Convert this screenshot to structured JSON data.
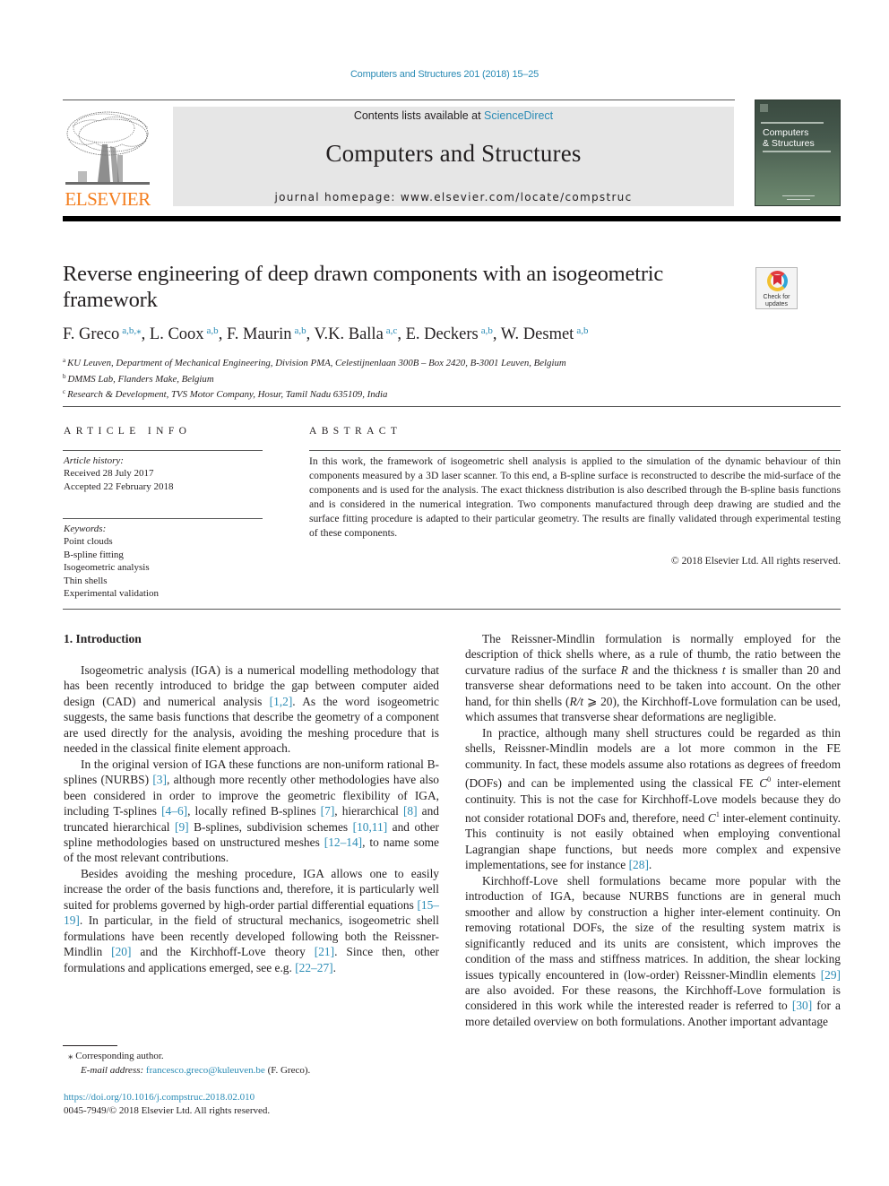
{
  "running_head": "Computers and Structures 201 (2018) 15–25",
  "masthead": {
    "publisher_wordmark": "ELSEVIER",
    "contents_prefix": "Contents lists available at ",
    "contents_link": "ScienceDirect",
    "journal_name": "Computers and Structures",
    "homepage_prefix": "journal homepage: ",
    "homepage_url": "www.elsevier.com/locate/compstruc",
    "cover_title_line1": "Computers",
    "cover_title_line2": "& Structures"
  },
  "check_updates": {
    "line1": "Check for",
    "line2": "updates"
  },
  "article": {
    "title": "Reverse engineering of deep drawn components with an isogeometric framework",
    "authors": [
      {
        "name": "F. Greco",
        "aff": "a,b,⁎",
        "sep": ", "
      },
      {
        "name": "L. Coox",
        "aff": "a,b",
        "sep": ", "
      },
      {
        "name": "F. Maurin",
        "aff": "a,b",
        "sep": ", "
      },
      {
        "name": "V.K. Balla",
        "aff": "a,c",
        "sep": ", "
      },
      {
        "name": "E. Deckers",
        "aff": "a,b",
        "sep": ", "
      },
      {
        "name": "W. Desmet",
        "aff": "a,b",
        "sep": ""
      }
    ],
    "affiliations": [
      {
        "mark": "a",
        "text": "KU Leuven, Department of Mechanical Engineering, Division PMA, Celestijnenlaan 300B – Box 2420, B-3001 Leuven, Belgium"
      },
      {
        "mark": "b",
        "text": "DMMS Lab, Flanders Make, Belgium"
      },
      {
        "mark": "c",
        "text": "Research & Development, TVS Motor Company, Hosur, Tamil Nadu 635109, India"
      }
    ]
  },
  "article_info": {
    "heading": "ARTICLE INFO",
    "history_label": "Article history:",
    "received": "Received 28 July 2017",
    "accepted": "Accepted 22 February 2018",
    "keywords_label": "Keywords:",
    "keywords": [
      "Point clouds",
      "B-spline fitting",
      "Isogeometric analysis",
      "Thin shells",
      "Experimental validation"
    ]
  },
  "abstract": {
    "heading": "ABSTRACT",
    "text": "In this work, the framework of isogeometric shell analysis is applied to the simulation of the dynamic behaviour of thin components measured by a 3D laser scanner. To this end, a B-spline surface is reconstructed to describe the mid-surface of the components and is used for the analysis. The exact thickness distribution is also described through the B-spline basis functions and is considered in the numerical integration. Two components manufactured through deep drawing are studied and the surface fitting procedure is adapted to their particular geometry. The results are finally validated through experimental testing of these components.",
    "copyright": "© 2018 Elsevier Ltd. All rights reserved."
  },
  "body": {
    "section_heading": "1. Introduction",
    "left_paragraphs": [
      [
        {
          "t": "Isogeometric analysis (IGA) is a numerical modelling methodology that has been recently introduced to bridge the gap between computer aided design (CAD) and numerical analysis "
        },
        {
          "ref": "[1,2]"
        },
        {
          "t": ". As the word isogeometric suggests, the same basis functions that describe the geometry of a component are used directly for the analysis, avoiding the meshing procedure that is needed in the classical finite element approach."
        }
      ],
      [
        {
          "t": "In the original version of IGA these functions are non-uniform rational B-splines (NURBS) "
        },
        {
          "ref": "[3]"
        },
        {
          "t": ", although more recently other methodologies have also been considered in order to improve the geometric flexibility of IGA, including T-splines "
        },
        {
          "ref": "[4–6]"
        },
        {
          "t": ", locally refined B-splines "
        },
        {
          "ref": "[7]"
        },
        {
          "t": ", hierarchical "
        },
        {
          "ref": "[8]"
        },
        {
          "t": " and truncated hierarchical "
        },
        {
          "ref": "[9]"
        },
        {
          "t": " B-splines, subdivision schemes "
        },
        {
          "ref": "[10,11]"
        },
        {
          "t": " and other spline methodologies based on unstructured meshes "
        },
        {
          "ref": "[12–14]"
        },
        {
          "t": ", to name some of the most relevant contributions."
        }
      ],
      [
        {
          "t": "Besides avoiding the meshing procedure, IGA allows one to easily increase the order of the basis functions and, therefore, it is particularly well suited for problems governed by high-order partial differential equations "
        },
        {
          "ref": "[15–19]"
        },
        {
          "t": ". In particular, in the field of structural mechanics, isogeometric shell formulations have been recently developed following both the Reissner-Mindlin "
        },
        {
          "ref": "[20]"
        },
        {
          "t": " and the Kirchhoff-Love theory "
        },
        {
          "ref": "[21]"
        },
        {
          "t": ". Since then, other formulations and applications emerged, see e.g. "
        },
        {
          "ref": "[22–27]"
        },
        {
          "t": "."
        }
      ]
    ],
    "right_paragraphs": [
      [
        {
          "t": "The Reissner-Mindlin formulation is normally employed for the description of thick shells where, as a rule of thumb, the ratio between the curvature radius of the surface "
        },
        {
          "i": "R"
        },
        {
          "t": " and the thickness "
        },
        {
          "i": "t"
        },
        {
          "t": " is smaller than 20 and transverse shear deformations need to be taken into account. On the other hand, for thin shells ("
        },
        {
          "i": "R/t"
        },
        {
          "t": " ⩾ 20), the Kirchhoff-Love formulation can be used, which assumes that transverse shear deformations are negligible."
        }
      ],
      [
        {
          "t": "In practice, although many shell structures could be regarded as thin shells, Reissner-Mindlin models are a lot more common in the FE community. In fact, these models assume also rotations as degrees of freedom (DOFs) and can be implemented using the classical FE "
        },
        {
          "i": "C",
          "sup": "0"
        },
        {
          "t": " inter-element continuity. This is not the case for Kirchhoff-Love models because they do not consider rotational DOFs and, therefore, need "
        },
        {
          "i": "C",
          "sup": "1"
        },
        {
          "t": " inter-element continuity. This continuity is not easily obtained when employing conventional Lagrangian shape functions, but needs more complex and expensive implementations, see for instance "
        },
        {
          "ref": "[28]"
        },
        {
          "t": "."
        }
      ],
      [
        {
          "t": "Kirchhoff-Love shell formulations became more popular with the introduction of IGA, because NURBS functions are in general much smoother and allow by construction a higher inter-element continuity. On removing rotational DOFs, the size of the resulting system matrix is significantly reduced and its units are consistent, which improves the condition of the mass and stiffness matrices. In addition, the shear locking issues typically encountered in (low-order) Reissner-Mindlin elements "
        },
        {
          "ref": "[29]"
        },
        {
          "t": " are also avoided. For these reasons, the Kirchhoff-Love formulation is considered in this work while the interested reader is referred to "
        },
        {
          "ref": "[30]"
        },
        {
          "t": " for a more detailed overview on both formulations. Another important advantage"
        }
      ]
    ]
  },
  "footnote": {
    "mark": "⁎",
    "corresponding": "Corresponding author.",
    "email_label": "E-mail address: ",
    "email": "francesco.greco@kuleuven.be",
    "email_suffix": " (F. Greco)."
  },
  "doi": {
    "url": "https://doi.org/10.1016/j.compstruc.2018.02.010",
    "issn_line": "0045-7949/© 2018 Elsevier Ltd. All rights reserved."
  },
  "colors": {
    "link": "#2a8bb5",
    "elsevier_orange": "#f47f20",
    "banner_grey": "#e6e6e6",
    "text": "#231f20"
  }
}
